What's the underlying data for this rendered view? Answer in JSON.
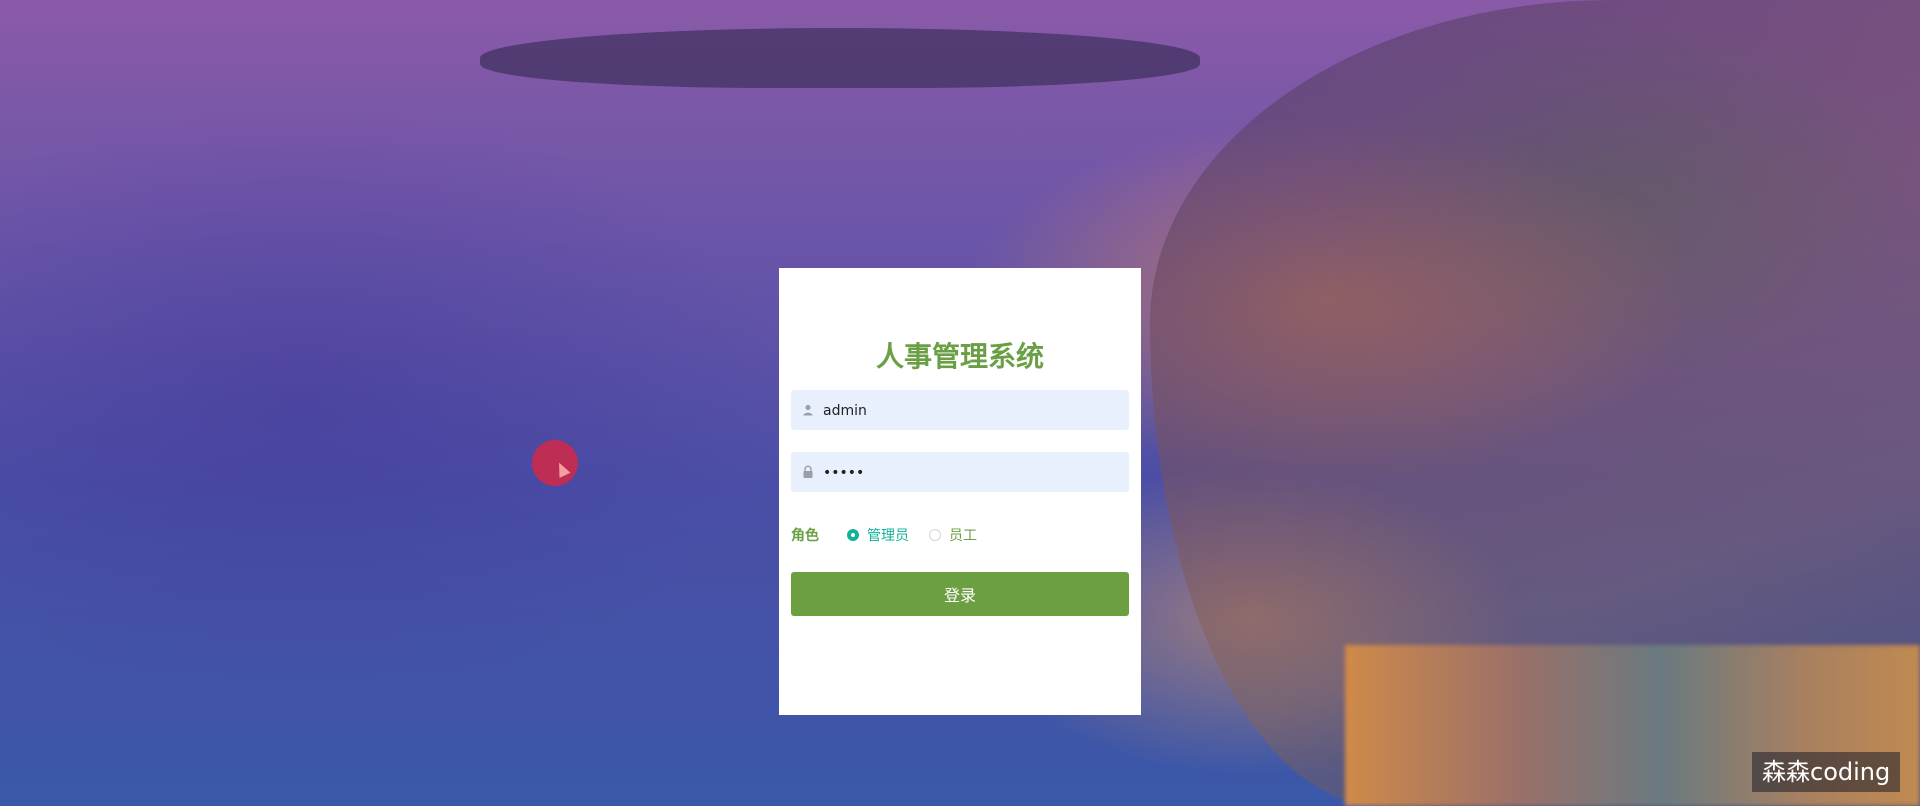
{
  "login": {
    "title": "人事管理系统",
    "username": {
      "value": "admin",
      "icon": "user-icon"
    },
    "password": {
      "value": "12345",
      "icon": "lock-icon"
    },
    "role": {
      "label": "角色",
      "options": [
        {
          "label": "管理员",
          "selected": true
        },
        {
          "label": "员工",
          "selected": false
        }
      ]
    },
    "submit_label": "登录"
  },
  "watermark": "森森coding",
  "colors": {
    "accent": "#6a9f45",
    "radio_selected": "#13b19a",
    "input_bg": "#e8f0fe",
    "button": "#6c9f41"
  }
}
